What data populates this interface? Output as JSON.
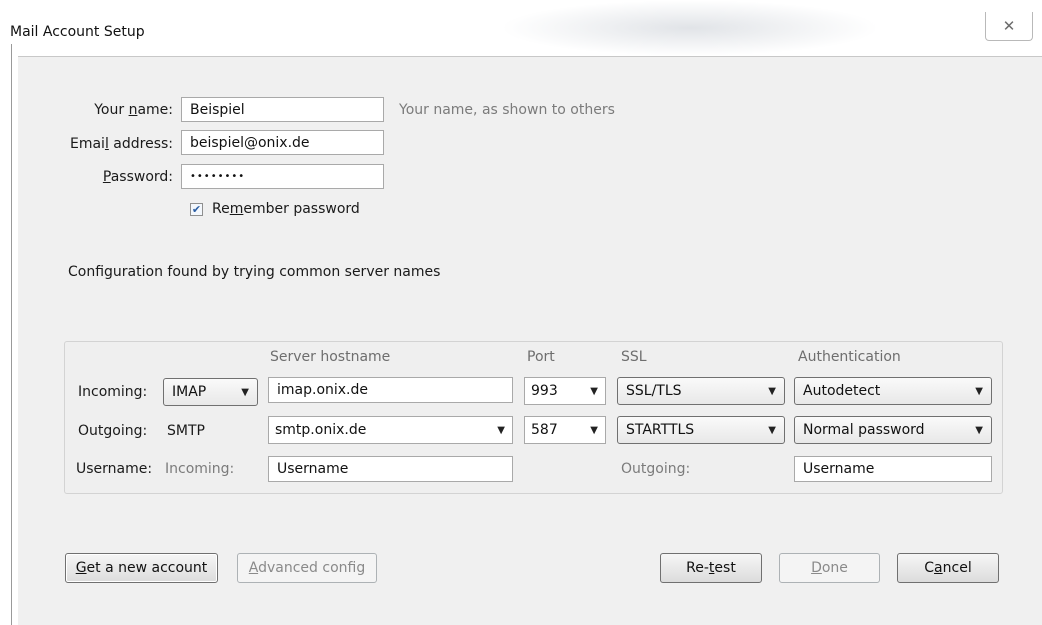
{
  "window": {
    "title": "Mail Account Setup",
    "close_glyph": "✕",
    "close_icon": "close-icon"
  },
  "account": {
    "name_label": "Your name:",
    "name_value": "Beispiel",
    "name_hint": "Your name, as shown to others",
    "email_label": "Email address:",
    "email_value": "beispiel@onix.de",
    "password_label": "Password:",
    "password_value": "••••••••",
    "remember_label": "Remember password",
    "remember_checked": true
  },
  "status_text": "Configuration found by trying common server names",
  "server": {
    "headers": {
      "hostname": "Server hostname",
      "port": "Port",
      "ssl": "SSL",
      "auth": "Authentication"
    },
    "incoming": {
      "label": "Incoming:",
      "protocol": "IMAP",
      "hostname": "imap.onix.de",
      "port": "993",
      "ssl": "SSL/TLS",
      "auth": "Autodetect"
    },
    "outgoing": {
      "label": "Outgoing:",
      "protocol": "SMTP",
      "hostname": "smtp.onix.de",
      "port": "587",
      "ssl": "STARTTLS",
      "auth": "Normal password"
    },
    "username": {
      "label": "Username:",
      "incoming_label": "Incoming:",
      "incoming_value": "Username",
      "outgoing_label": "Outgoing:",
      "outgoing_value": "Username"
    }
  },
  "buttons": {
    "get_account": "Get a new account",
    "advanced": "Advanced config",
    "retest": "Re-test",
    "done": "Done",
    "cancel": "Cancel"
  }
}
